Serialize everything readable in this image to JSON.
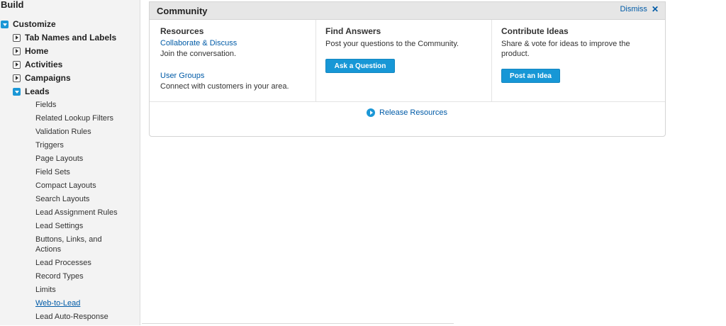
{
  "sidebar": {
    "title": "Build",
    "customize": "Customize",
    "sections": [
      {
        "label": "Tab Names and Labels",
        "expanded": false
      },
      {
        "label": "Home",
        "expanded": false
      },
      {
        "label": "Activities",
        "expanded": false
      },
      {
        "label": "Campaigns",
        "expanded": false
      },
      {
        "label": "Leads",
        "expanded": true
      }
    ],
    "lead_items": [
      "Fields",
      "Related Lookup Filters",
      "Validation Rules",
      "Triggers",
      "Page Layouts",
      "Field Sets",
      "Compact Layouts",
      "Search Layouts",
      "Lead Assignment Rules",
      "Lead Settings",
      "Buttons, Links, and",
      "Actions",
      "Lead Processes",
      "Record Types",
      "Limits",
      "Web-to-Lead",
      "Lead Auto-Response"
    ]
  },
  "community": {
    "title": "Community",
    "dismiss": "Dismiss",
    "resources": {
      "heading": "Resources",
      "link1": "Collaborate & Discuss",
      "text1": "Join the conversation.",
      "link2": "User Groups",
      "text2": "Connect with customers in your area."
    },
    "answers": {
      "heading": "Find Answers",
      "text": "Post your questions to the Community.",
      "button": "Ask a Question"
    },
    "ideas": {
      "heading": "Contribute Ideas",
      "text1": "Share & vote for ideas to improve the",
      "text2": "product.",
      "button": "Post an Idea"
    },
    "release": "Release Resources"
  },
  "colors": {
    "accent": "#1797d6",
    "link": "#015ba7",
    "sidebar_bg": "#f3f3f3"
  }
}
